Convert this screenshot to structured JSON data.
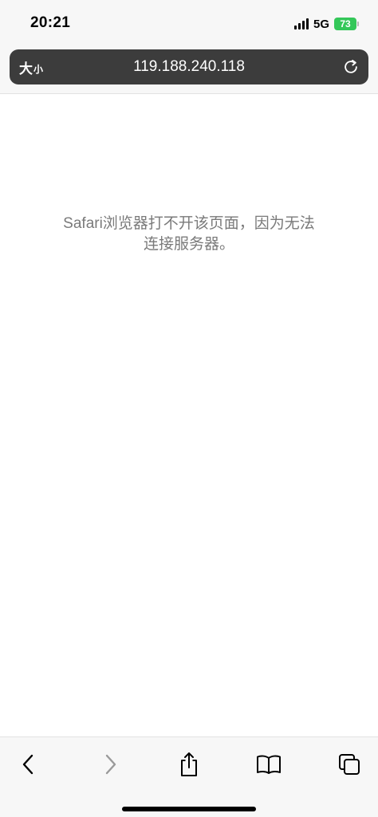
{
  "status_bar": {
    "time": "20:21",
    "network": "5G",
    "battery": "73"
  },
  "address_bar": {
    "text_size_large": "大",
    "text_size_small": "小",
    "url": "119.188.240.118"
  },
  "page": {
    "error_line_1": "Safari浏览器打不开该页面，因为无法",
    "error_line_2": "连接服务器。"
  },
  "toolbar": {
    "icons": [
      "back-icon",
      "forward-icon",
      "share-icon",
      "bookmarks-icon",
      "tabs-icon"
    ]
  },
  "colors": {
    "chrome_bg": "#f7f7f7",
    "address_bar_bg": "#3c3c3c",
    "battery_green": "#34c759",
    "message_gray": "#7a7a7a",
    "toolbar_active": "#000000",
    "toolbar_disabled": "#9a9a9a"
  }
}
